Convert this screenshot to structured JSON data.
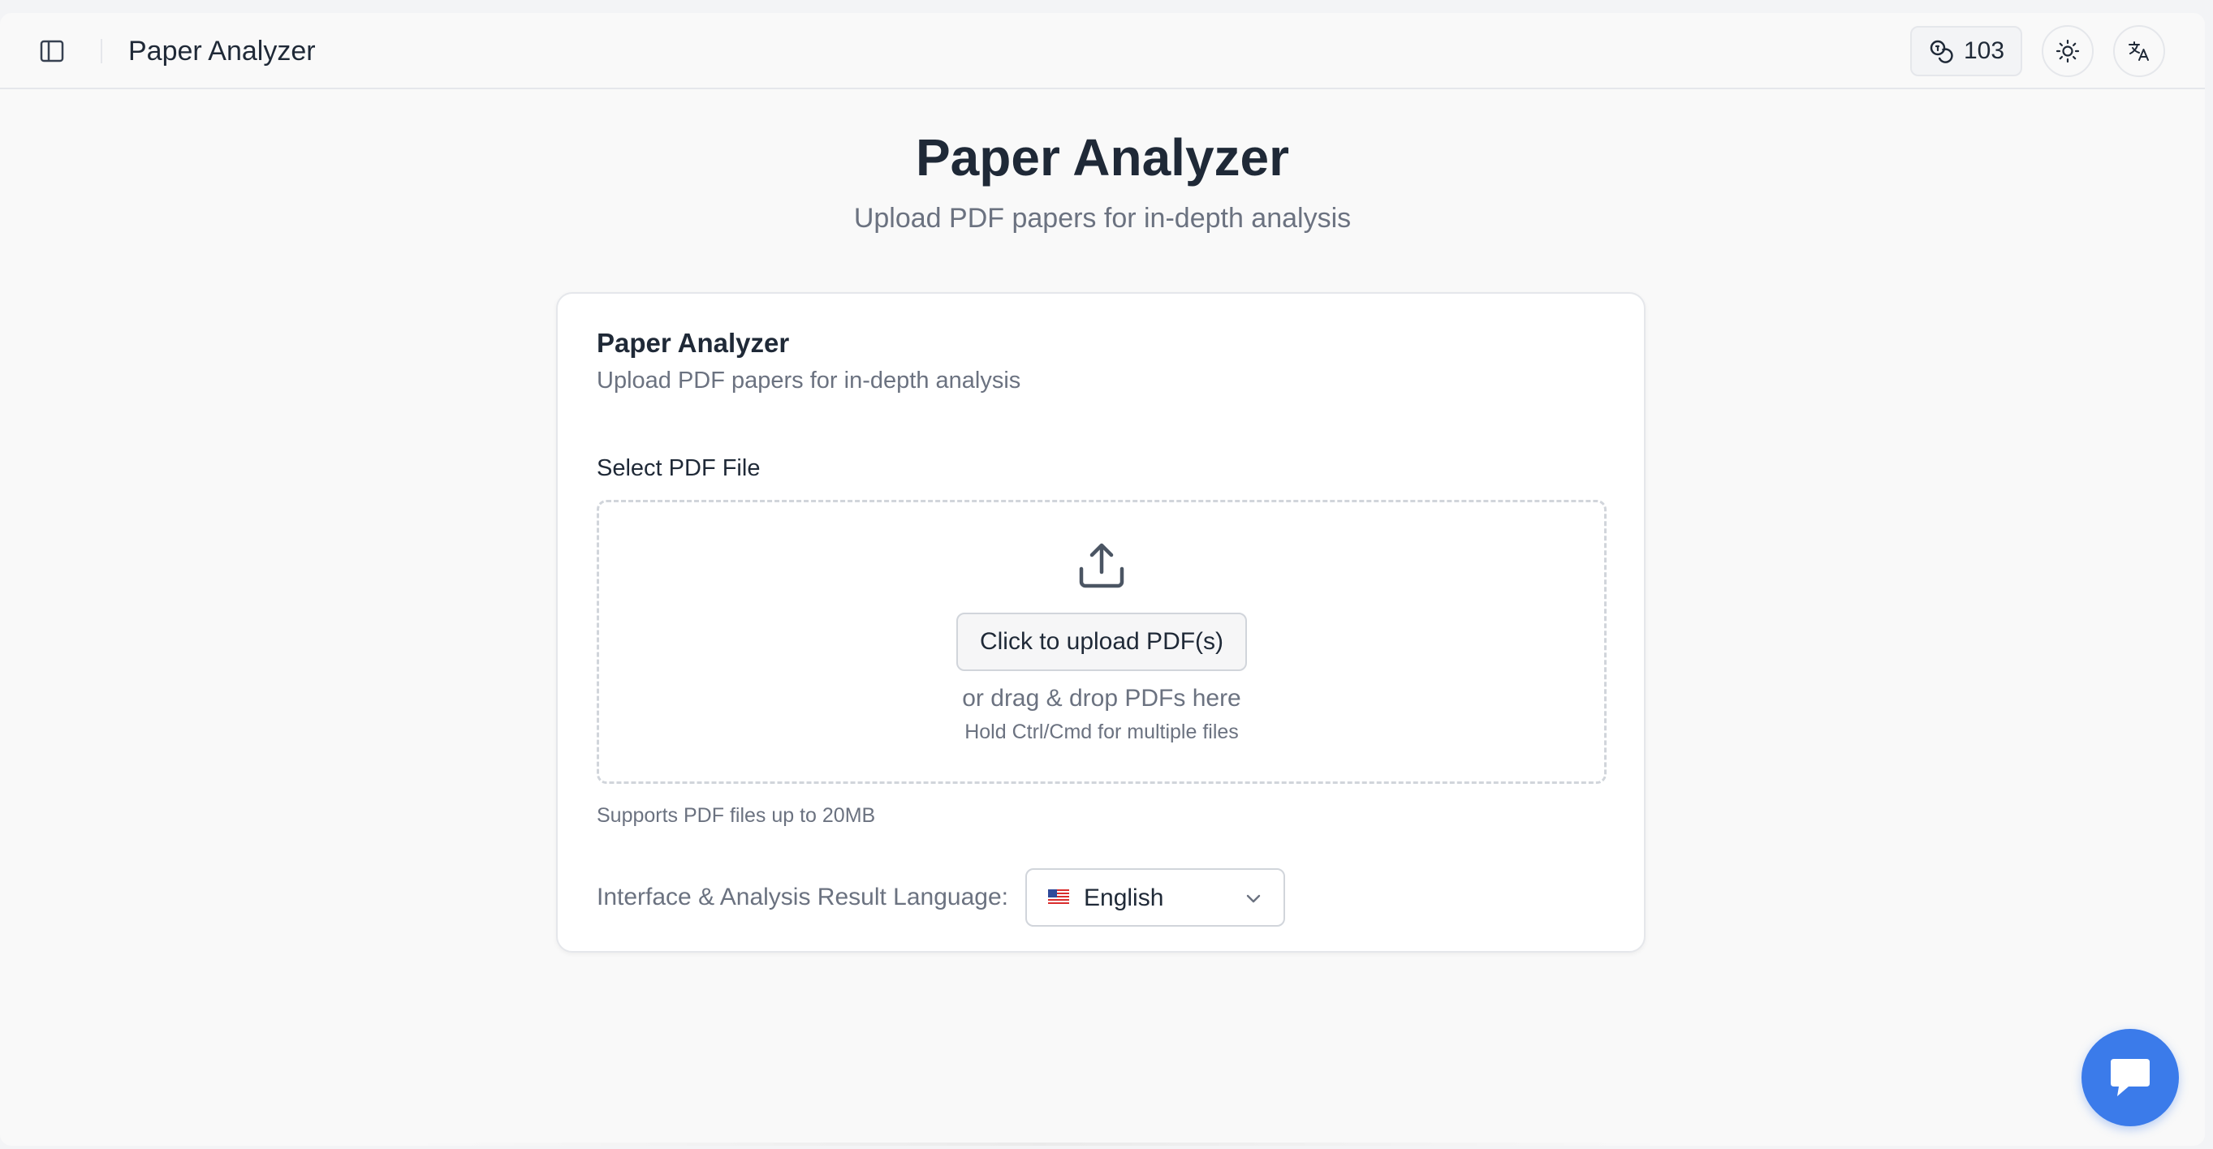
{
  "header": {
    "title": "Paper Analyzer",
    "credits": "103"
  },
  "page": {
    "title": "Paper Analyzer",
    "subtitle": "Upload PDF papers for in-depth analysis"
  },
  "card": {
    "title": "Paper Analyzer",
    "subtitle": "Upload PDF papers for in-depth analysis",
    "file_label": "Select PDF File",
    "upload_button": "Click to upload PDF(s)",
    "drag_text": "or drag & drop PDFs here",
    "hint_text": "Hold Ctrl/Cmd for multiple files",
    "support_text": "Supports PDF files up to 20MB",
    "language_label": "Interface & Analysis Result Language:",
    "language_value": "English"
  },
  "icons": {
    "sidebar_toggle": "sidebar-panel-icon",
    "credits": "coins-icon",
    "theme": "sun-icon",
    "language": "translate-icon",
    "upload": "upload-icon",
    "flag": "us-flag-icon",
    "select": "chevron-down-icon",
    "chat": "chat-bubble-icon"
  },
  "colors": {
    "accent": "#3b7bea",
    "background": "#f9f9f9",
    "card": "#ffffff",
    "muted_text": "#6b7280"
  }
}
